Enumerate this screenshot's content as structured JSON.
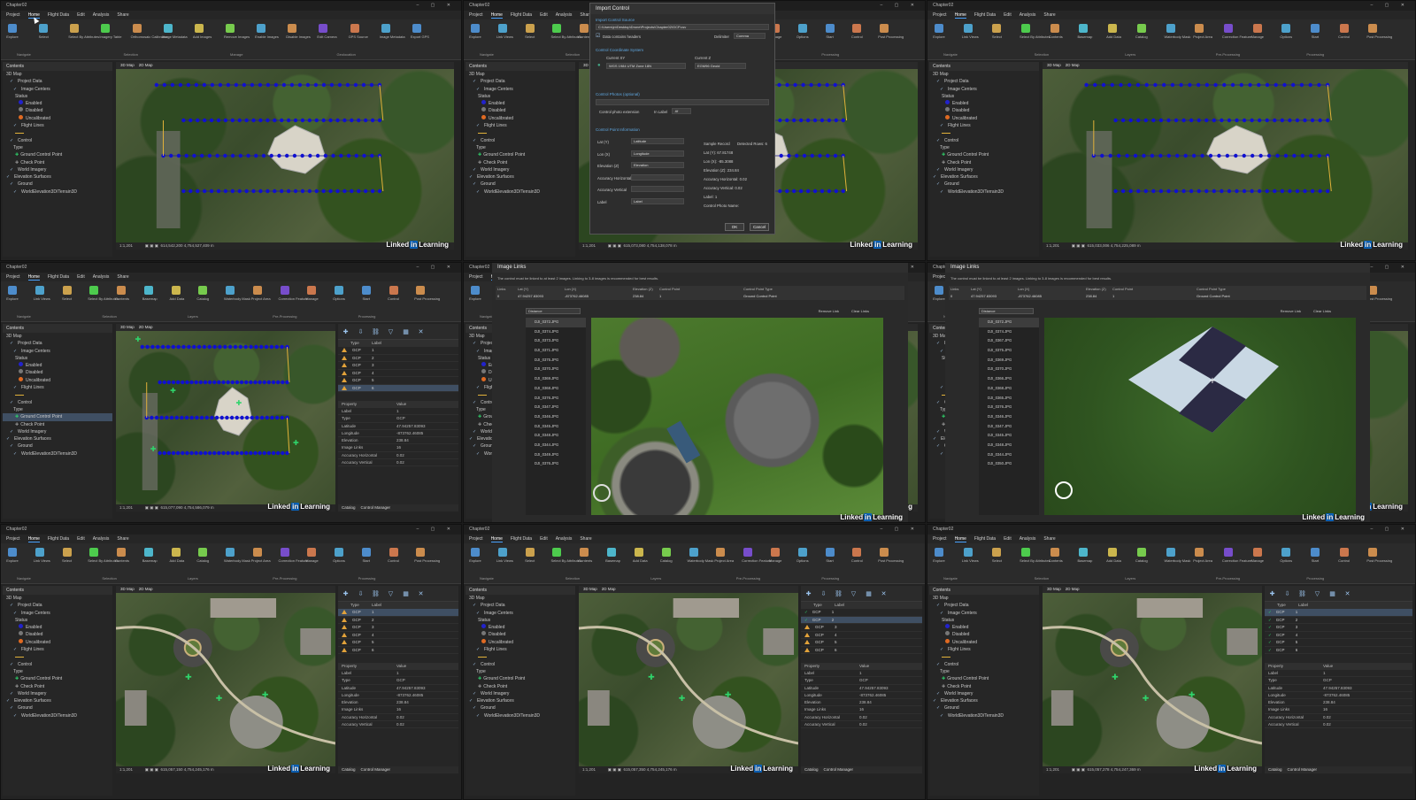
{
  "panel_title": "Chapter02",
  "menu": [
    "Project",
    "Home",
    "Flight Data",
    "Edit",
    "Analysis",
    "Share"
  ],
  "ribbon_tools": [
    "Explore",
    "Link Views",
    "Select",
    "Select By Attributes",
    "Contents",
    "Basemap",
    "Add Data",
    "Catalog",
    "Waterbody Mask",
    "Project Area",
    "Correction Feature",
    "Manage",
    "Options",
    "Start",
    "Control",
    "Post Processing"
  ],
  "ribbon_tools_first": [
    "Explore",
    "Select",
    "Select By Attributes",
    "Imagery Table",
    "Orthomosaic Calibration",
    "Image Metadata",
    "Add Images",
    "Remove Images",
    "Enable Images",
    "Disable Images",
    "Edit Camera",
    "GPS Source",
    "Image Metadata",
    "Export GPS"
  ],
  "ribbon_groups": [
    "Navigate",
    "Selection",
    "Layers",
    "Pre-Processing",
    "Processing"
  ],
  "ribbon_groups_first": [
    "Navigate",
    "Selection",
    "Manage",
    "Geolocation"
  ],
  "contents": {
    "title": "Contents",
    "items": [
      "3D Map",
      "Project Data",
      "Image Centers",
      "Status",
      "Enabled",
      "Disabled",
      "Uncalibrated",
      "Flight Lines",
      "",
      "Control",
      "Type",
      "Ground Control Point",
      "Check Point",
      "World Imagery",
      "Elevation Surfaces",
      "Ground",
      "WorldElevation3D/Terrain3D"
    ]
  },
  "map": {
    "tabs": [
      "3D Map",
      "2D Map"
    ],
    "scale": "1:1,201",
    "coords_top": [
      "614,542,200 4,754,527,409 m",
      "615,073,080 4,754,138,078 m",
      "615,033,006 4,754,225,089 m"
    ],
    "coords_mid": "615,077,090 4,754,586,079 m",
    "coords_bot": [
      "615,057,150 4,754,245,176 m",
      "615,057,350 4,754,245,176 m",
      "615,057,278 4,754,247,369 m"
    ]
  },
  "watermark": {
    "pre": "Linked",
    "brand": "in",
    "post": "Learning"
  },
  "import_control": {
    "title": "Import Control",
    "file_label": "Import Control Source",
    "file_path": "C:\\Users\\jn\\Desktop\\Drone\\Projects\\Chapter02\\GCP.csv",
    "data_header": "Data contains headers",
    "delimiter_label": "Delimiter",
    "delimiter": "Comma",
    "cs_label": "Control Coordinate System",
    "current_xy_label": "Current XY",
    "current_xy": "WGS 1984 UTM Zone 18N",
    "current_z_label": "Current Z",
    "current_z": "EGM96 Geoid",
    "photos_label": "Control Photos (optional)",
    "photo_ext_label": "Control photo extension",
    "in_label": "In Label",
    "ext": ".tif",
    "field_info": "Control Point Information",
    "fields": [
      {
        "name": "Lat (Y)",
        "value": "Latitude"
      },
      {
        "name": "Lon (X)",
        "value": "Longitude"
      },
      {
        "name": "Elevation (Z)",
        "value": "Elevation"
      },
      {
        "name": "Accuracy Horizontal",
        "value": ""
      },
      {
        "name": "Accuracy Vertical",
        "value": ""
      },
      {
        "name": "Label",
        "value": "Label"
      }
    ],
    "sample_title": "Sample Record",
    "detected": "Detected Rows: 6",
    "sample": [
      "Lat (Y): 67.81748",
      "Lon (X): -85.3088",
      "Elevation (Z): 234.84",
      "Accuracy Horizontal: 0.02",
      "Accuracy Vertical: 0.02",
      "Label: 1",
      "Control Photo Name:"
    ],
    "ok": "OK",
    "cancel": "Cancel"
  },
  "image_links": {
    "title": "Image Links",
    "note": "The control must be linked to at least 2 images. Linking to 3-8 images is recommended for best results.",
    "headers": [
      "Links",
      "Lat (Y)",
      "Lon (X)",
      "Elevation (Z)",
      "Control Point",
      "Control Point Type"
    ],
    "row": [
      "0",
      "47.94257.83093",
      "-873762.46085",
      "238.84",
      "1",
      "Ground Control Point"
    ],
    "sort": "Distance",
    "remove_link": "Remove Link",
    "clear_links": "Clear Links",
    "images_a": [
      "DJI_0372.JPG",
      "DJI_0374.JPG",
      "DJI_0373.JPG",
      "DJI_0371.JPG",
      "DJI_0375.JPG",
      "DJI_0370.JPG",
      "DJI_0369.JPG",
      "DJI_0368.JPG",
      "DJI_0376.JPG",
      "DJI_0347.JPG",
      "DJI_0346.JPG",
      "DJI_0345.JPG",
      "DJI_0348.JPG",
      "DJI_0344.JPG",
      "DJI_0349.JPG",
      "DJI_0376.JPG"
    ],
    "images_b": [
      "DJI_0372.JPG",
      "DJI_0374.JPG",
      "DJI_0367.JPG",
      "DJI_0375.JPG",
      "DJI_0369.JPG",
      "DJI_0370.JPG",
      "DJI_0366.JPG",
      "DJI_0368.JPG",
      "DJI_0365.JPG",
      "DJI_0376.JPG",
      "DJI_0346.JPG",
      "DJI_0347.JPG",
      "DJI_0345.JPG",
      "DJI_0348.JPG",
      "DJI_0344.JPG",
      "DJI_0350.JPG"
    ]
  },
  "control_manager": {
    "headers": [
      "Type",
      "Label"
    ],
    "rows": [
      {
        "type": "GCP",
        "label": "1"
      },
      {
        "type": "GCP",
        "label": "2"
      },
      {
        "type": "GCP",
        "label": "3"
      },
      {
        "type": "GCP",
        "label": "4"
      },
      {
        "type": "GCP",
        "label": "5"
      },
      {
        "type": "GCP",
        "label": "6"
      }
    ],
    "prop_headers": [
      "Property",
      "Value"
    ],
    "props": [
      {
        "k": "Label",
        "v": "1"
      },
      {
        "k": "Type",
        "v": "GCP"
      },
      {
        "k": "Latitude",
        "v": "47.94257.83093"
      },
      {
        "k": "Longitude",
        "v": "-873762.46085"
      },
      {
        "k": "Elevation",
        "v": "238.84"
      },
      {
        "k": "Image Links",
        "v": "16"
      },
      {
        "k": "Accuracy Horizontal",
        "v": "0.02"
      },
      {
        "k": "Accuracy Vertical",
        "v": "0.02"
      }
    ],
    "tabs": [
      "Catalog",
      "Control Manager"
    ]
  },
  "colors": {
    "accent": "#4aa3ff",
    "flight_dots": "#1010d0",
    "gcp_warning": "#e2a23a",
    "gcp_ok": "#2fd46b",
    "panel_bg": "#232323"
  }
}
